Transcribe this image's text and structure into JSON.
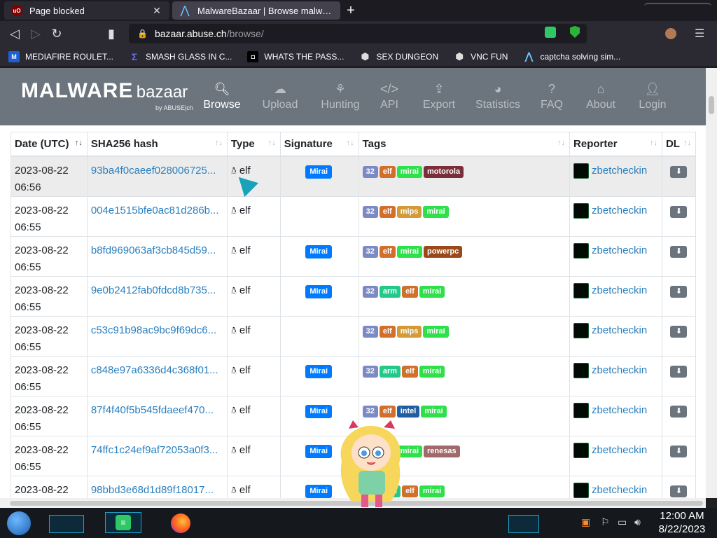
{
  "browser": {
    "tabs": [
      {
        "title": "Page blocked",
        "favicon": "ublock-icon"
      },
      {
        "title": "MalwareBazaar | Browse malware samples",
        "favicon": "malwarebazaar-icon"
      }
    ],
    "url_host": "bazaar.abuse.ch",
    "url_path": "/browse/",
    "bookmarks": [
      {
        "label": "MEDIAFIRE ROULET...",
        "icon": "mediafire-icon",
        "color": "#1e5fd6"
      },
      {
        "label": "SMASH GLASS IN C...",
        "icon": "smash-icon",
        "color": "#3a3ad6"
      },
      {
        "label": "WHATS THE PASS...",
        "icon": "ghost-icon",
        "color": "#222222"
      },
      {
        "label": "SEX DUNGEON",
        "icon": "cube-icon",
        "color": "#555555"
      },
      {
        "label": "VNC FUN",
        "icon": "cube-icon",
        "color": "#555555"
      },
      {
        "label": "captcha solving sim...",
        "icon": "triangle-icon",
        "color": "#2a2a2a"
      }
    ]
  },
  "site": {
    "logo_main": "MALWARE",
    "logo_sub": "bazaar",
    "logo_by": "by ABUSE|ch",
    "nav": [
      {
        "label": "Browse",
        "icon": "search-icon",
        "active": true
      },
      {
        "label": "Upload",
        "icon": "cloud-upload-icon"
      },
      {
        "label": "Hunting",
        "icon": "binoculars-icon"
      },
      {
        "label": "API",
        "icon": "code-icon"
      },
      {
        "label": "Export",
        "icon": "export-icon"
      },
      {
        "label": "Statistics",
        "icon": "pie-chart-icon"
      },
      {
        "label": "FAQ",
        "icon": "question-icon"
      },
      {
        "label": "About",
        "icon": "building-icon"
      },
      {
        "label": "Login",
        "icon": "user-icon"
      }
    ]
  },
  "table": {
    "headers": [
      "Date (UTC)",
      "SHA256 hash",
      "Type",
      "Signature",
      "Tags",
      "Reporter",
      "DL"
    ],
    "rows": [
      {
        "date": "2023-08-22",
        "time": "06:56",
        "hash": "93ba4f0caeef028006725...",
        "type": "elf",
        "signature": "Mirai",
        "tags": [
          "32",
          "elf",
          "mirai",
          "motorola"
        ],
        "reporter": "zbetcheckin"
      },
      {
        "date": "2023-08-22",
        "time": "06:55",
        "hash": "004e1515bfe0ac81d286b...",
        "type": "elf",
        "signature": "",
        "tags": [
          "32",
          "elf",
          "mips",
          "mirai"
        ],
        "reporter": "zbetcheckin"
      },
      {
        "date": "2023-08-22",
        "time": "06:55",
        "hash": "b8fd969063af3cb845d59...",
        "type": "elf",
        "signature": "Mirai",
        "tags": [
          "32",
          "elf",
          "mirai",
          "powerpc"
        ],
        "reporter": "zbetcheckin"
      },
      {
        "date": "2023-08-22",
        "time": "06:55",
        "hash": "9e0b2412fab0fdcd8b735...",
        "type": "elf",
        "signature": "Mirai",
        "tags": [
          "32",
          "arm",
          "elf",
          "mirai"
        ],
        "reporter": "zbetcheckin"
      },
      {
        "date": "2023-08-22",
        "time": "06:55",
        "hash": "c53c91b98ac9bc9f69dc6...",
        "type": "elf",
        "signature": "",
        "tags": [
          "32",
          "elf",
          "mips",
          "mirai"
        ],
        "reporter": "zbetcheckin"
      },
      {
        "date": "2023-08-22",
        "time": "06:55",
        "hash": "c848e97a6336d4c368f01...",
        "type": "elf",
        "signature": "Mirai",
        "tags": [
          "32",
          "arm",
          "elf",
          "mirai"
        ],
        "reporter": "zbetcheckin"
      },
      {
        "date": "2023-08-22",
        "time": "06:55",
        "hash": "87f4f40f5b545fdaeef470...",
        "type": "elf",
        "signature": "Mirai",
        "tags": [
          "32",
          "elf",
          "intel",
          "mirai"
        ],
        "reporter": "zbetcheckin"
      },
      {
        "date": "2023-08-22",
        "time": "06:55",
        "hash": "74ffc1c24ef9af72053a0f3...",
        "type": "elf",
        "signature": "Mirai",
        "tags": [
          "32",
          "elf",
          "mirai",
          "renesas"
        ],
        "reporter": "zbetcheckin"
      },
      {
        "date": "2023-08-22",
        "time": "",
        "hash": "98bbd3e68d1d89f18017...",
        "type": "elf",
        "signature": "Mirai",
        "tags": [
          "32",
          "arm",
          "elf",
          "mirai"
        ],
        "reporter": "zbetcheckin"
      }
    ],
    "tag_colors": {
      "32": "#7b8ac4",
      "elf": "#d0702c",
      "mirai": "#2ee04a",
      "motorola": "#7a2e3a",
      "mips": "#d39a3a",
      "powerpc": "#9a4a1a",
      "arm": "#22c98a",
      "intel": "#1f5fa0",
      "renesas": "#a06a6a"
    }
  },
  "taskbar": {
    "time": "12:00 AM",
    "date": "8/22/2023"
  }
}
